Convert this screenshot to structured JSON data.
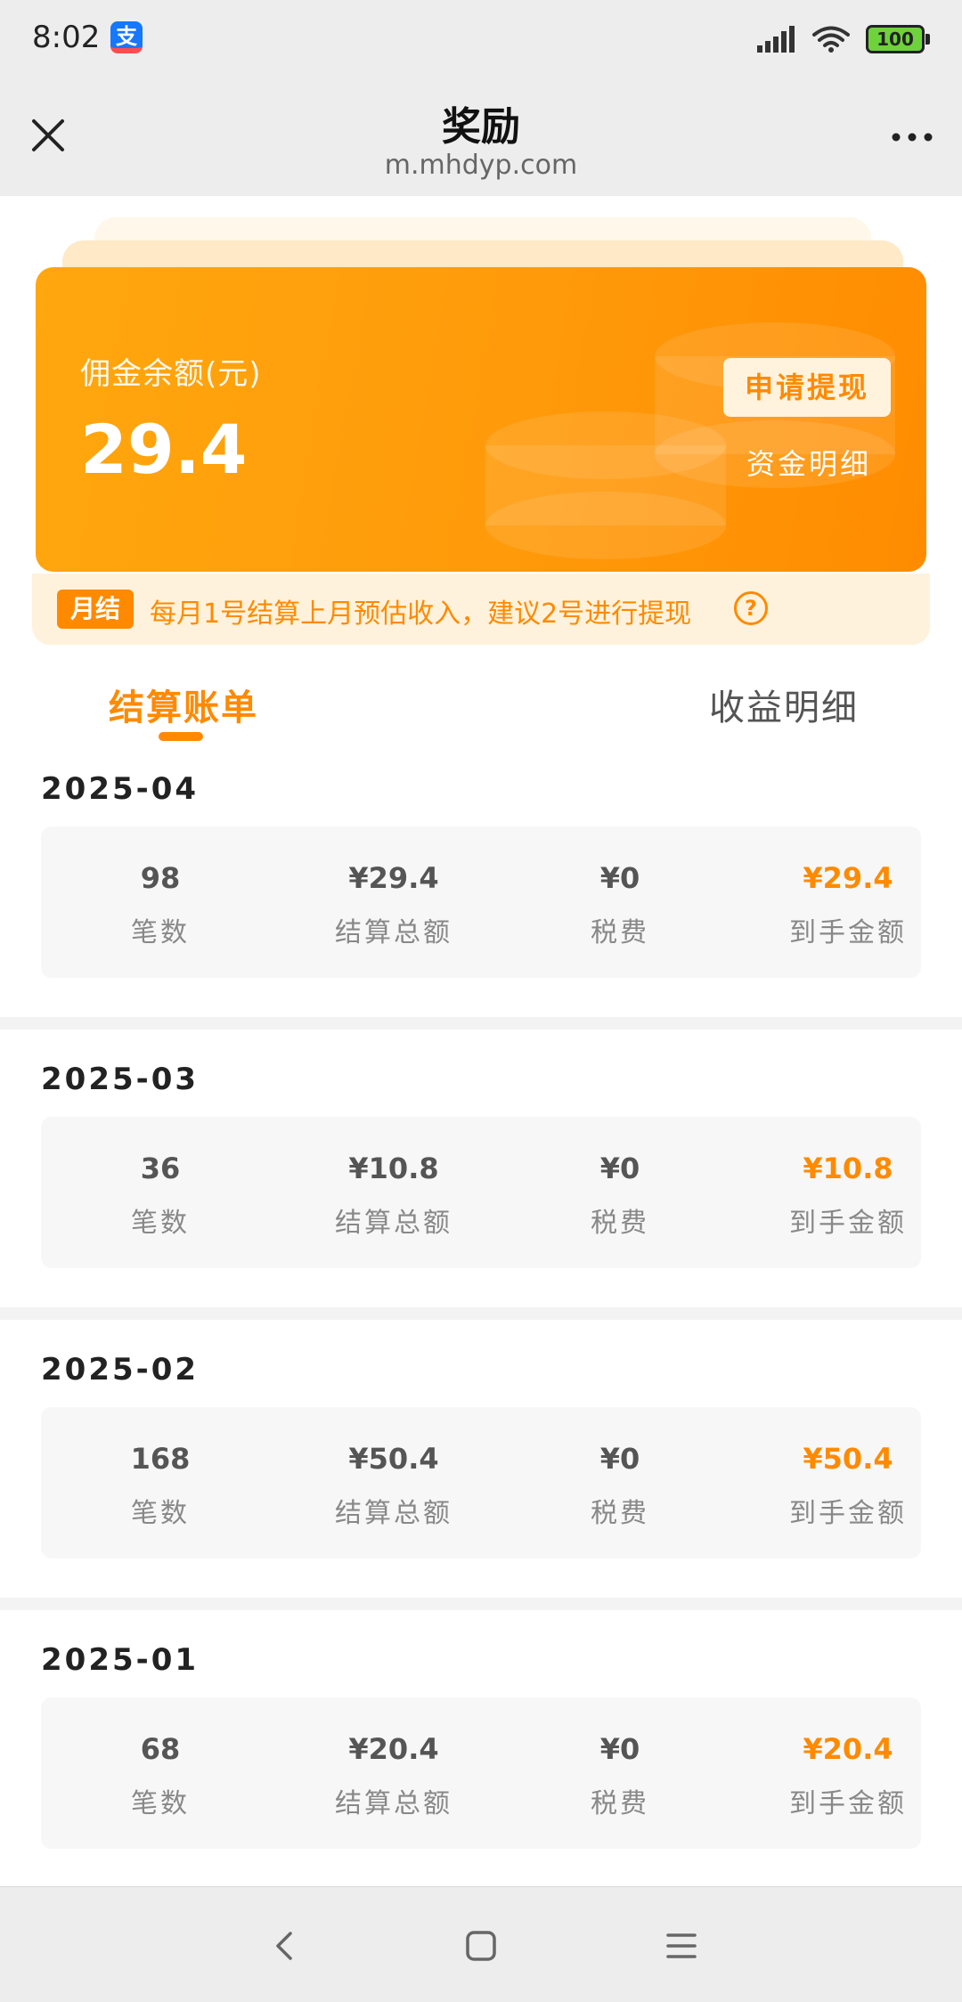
{
  "status_bar": {
    "time": "8:02",
    "app_icon_glyph": "支",
    "battery": "100",
    "icons": [
      "signal-icon",
      "wifi-icon",
      "battery-icon"
    ]
  },
  "header": {
    "title": "奖励",
    "url": "m.mhdyp.com",
    "icons": [
      "close-icon",
      "more-icon"
    ]
  },
  "balance_card": {
    "label": "佣金余额(元)",
    "value": "29.4",
    "withdraw_label": "申请提现",
    "detail_link": "资金明细"
  },
  "notice": {
    "badge": "月结",
    "text": "每月1号结算上月预估收入，建议2号进行提现",
    "help_glyph": "?"
  },
  "tabs": [
    {
      "label": "结算账单",
      "active": true
    },
    {
      "label": "收益明细",
      "active": false
    }
  ],
  "stat_labels": [
    "笔数",
    "结算总额",
    "税费",
    "到手金额"
  ],
  "months": [
    {
      "month": "2025-04",
      "count": "98",
      "total": "¥29.4",
      "tax": "¥0",
      "net": "¥29.4"
    },
    {
      "month": "2025-03",
      "count": "36",
      "total": "¥10.8",
      "tax": "¥0",
      "net": "¥10.8"
    },
    {
      "month": "2025-02",
      "count": "168",
      "total": "¥50.4",
      "tax": "¥0",
      "net": "¥50.4"
    },
    {
      "month": "2025-01",
      "count": "68",
      "total": "¥20.4",
      "tax": "¥0",
      "net": "¥20.4"
    }
  ],
  "colors": {
    "accent": "#ff8a00",
    "card_gradient_start": "#ffa70e",
    "card_gradient_end": "#ff8c00",
    "page_background": "#ffffff",
    "bar_background": "#ededed"
  }
}
